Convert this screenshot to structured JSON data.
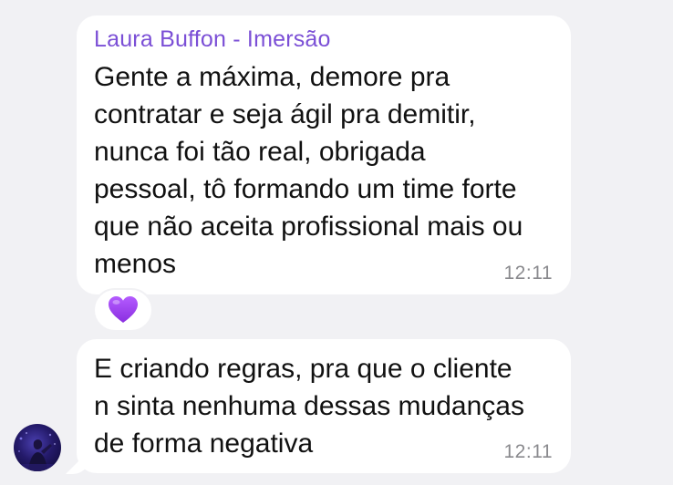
{
  "messages": [
    {
      "sender": "Laura Buffon - Imersão",
      "text": "Gente a máxima, demore pra\ncontratar e seja ágil pra demitir,\nnunca foi tão real, obrigada\npessoal, tô formando um time forte\nque não aceita profissional mais ou\nmenos",
      "time": "12:11",
      "reaction": {
        "emoji": "purple-heart-icon"
      }
    },
    {
      "text": "E criando regras, pra que o cliente\nn sinta nenhuma dessas mudanças\nde forma negativa",
      "time": "12:11"
    }
  ],
  "colors": {
    "background": "#f1f1f4",
    "bubble": "#ffffff",
    "sender_name": "#7b4fd6",
    "timestamp": "#8a8a8e",
    "heart": "#9b3df0"
  }
}
